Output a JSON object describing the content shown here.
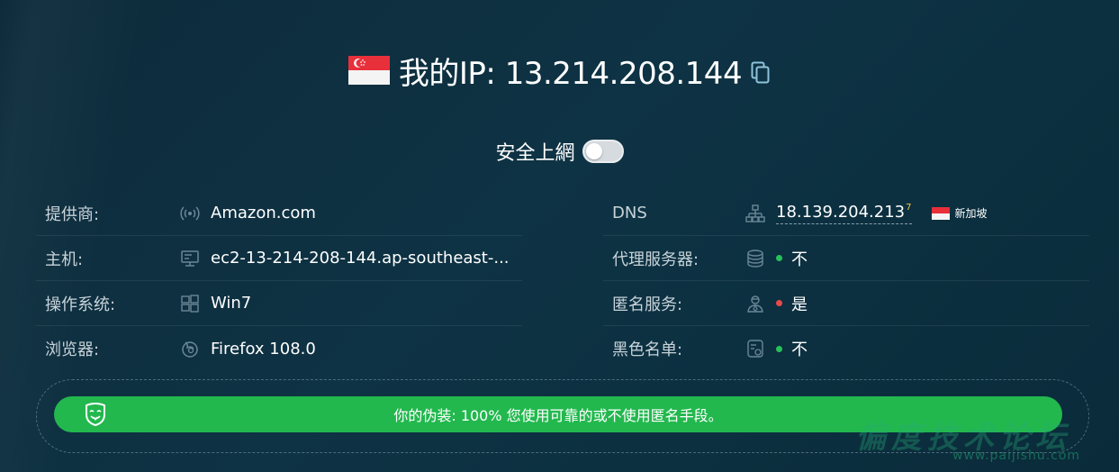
{
  "header": {
    "flag_country": "Singapore",
    "ip_label": "我的IP: 13.214.208.144"
  },
  "secure": {
    "label": "安全上網",
    "enabled": false
  },
  "left_rows": [
    {
      "label": "提供商:",
      "value": "Amazon.com",
      "icon": "broadcast-icon"
    },
    {
      "label": "主机:",
      "value": "ec2-13-214-208-144.ap-southeast-...",
      "icon": "server-icon"
    },
    {
      "label": "操作系统:",
      "value": "Win7",
      "icon": "windows-icon"
    },
    {
      "label": "浏览器:",
      "value": "Firefox 108.0",
      "icon": "browser-icon"
    }
  ],
  "right_rows": {
    "dns": {
      "label": "DNS",
      "value": "18.139.204.213",
      "count": "7",
      "country": "新加坡",
      "icon": "network-icon"
    },
    "proxy": {
      "label": "代理服务器:",
      "value": "不",
      "status": "green",
      "icon": "database-icon"
    },
    "anonymizer": {
      "label": "匿名服务:",
      "value": "是",
      "status": "red",
      "icon": "agent-icon"
    },
    "blacklist": {
      "label": "黑色名单:",
      "value": "不",
      "status": "green",
      "icon": "blacklist-icon"
    }
  },
  "disguise": {
    "text": "你的伪装: 100% 您使用可靠的或不使用匿名手段。",
    "icon": "mask-icon"
  },
  "watermark": {
    "big": "偏度技术论坛",
    "small": "www.paijishu.com"
  },
  "colors": {
    "background": "#0e3344",
    "accent_green": "#22b84e",
    "status_green": "#27c25a",
    "status_red": "#e8494b",
    "flag_red": "#e8303b"
  }
}
